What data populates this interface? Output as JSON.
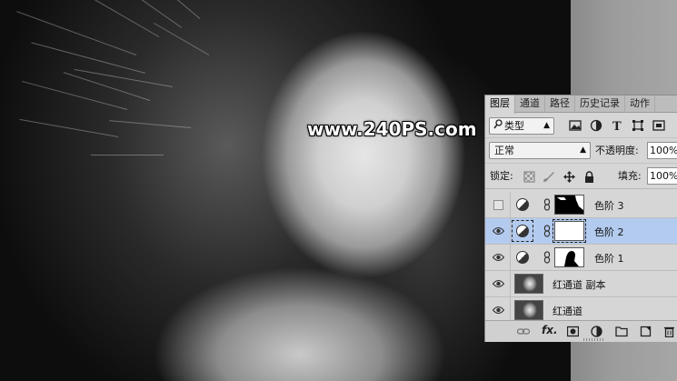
{
  "watermark": "www.240PS.com",
  "panel": {
    "tabs": [
      "图层",
      "通道",
      "路径",
      "历史记录",
      "动作"
    ],
    "active_tab": "图层",
    "filter": {
      "search_icon": "search-icon",
      "value": "类型"
    },
    "filter_icons": [
      "image-filter-icon",
      "adjustment-filter-icon",
      "type-filter-icon",
      "shape-filter-icon",
      "smart-object-filter-icon"
    ],
    "blend_mode": "正常",
    "opacity_label": "不透明度:",
    "opacity_value": "100%",
    "lock_label": "锁定:",
    "lock_icons": [
      "lock-transparent-icon",
      "lock-image-icon",
      "lock-position-icon",
      "lock-all-icon"
    ],
    "fill_label": "填充:",
    "fill_value": "100%",
    "layers": [
      {
        "name": "色阶 3",
        "visible": false,
        "type": "adjustment",
        "selected": false,
        "mask": "white-top-right"
      },
      {
        "name": "色阶 2",
        "visible": true,
        "type": "adjustment",
        "selected": true,
        "mask": "white"
      },
      {
        "name": "色阶 1",
        "visible": true,
        "type": "adjustment",
        "selected": false,
        "mask": "silhouette"
      },
      {
        "name": "红通道 副本",
        "visible": true,
        "type": "pixel",
        "selected": false
      },
      {
        "name": "红通道",
        "visible": true,
        "type": "pixel",
        "selected": false
      }
    ],
    "footer_icons": [
      "link-layers-icon",
      "fx-icon",
      "add-mask-icon",
      "new-adjustment-icon",
      "new-group-icon",
      "new-layer-icon",
      "delete-icon"
    ],
    "footer_fx": "fx."
  },
  "colors": {
    "panel_bg": "#d6d6d6",
    "selected_row": "#b3cbef"
  }
}
